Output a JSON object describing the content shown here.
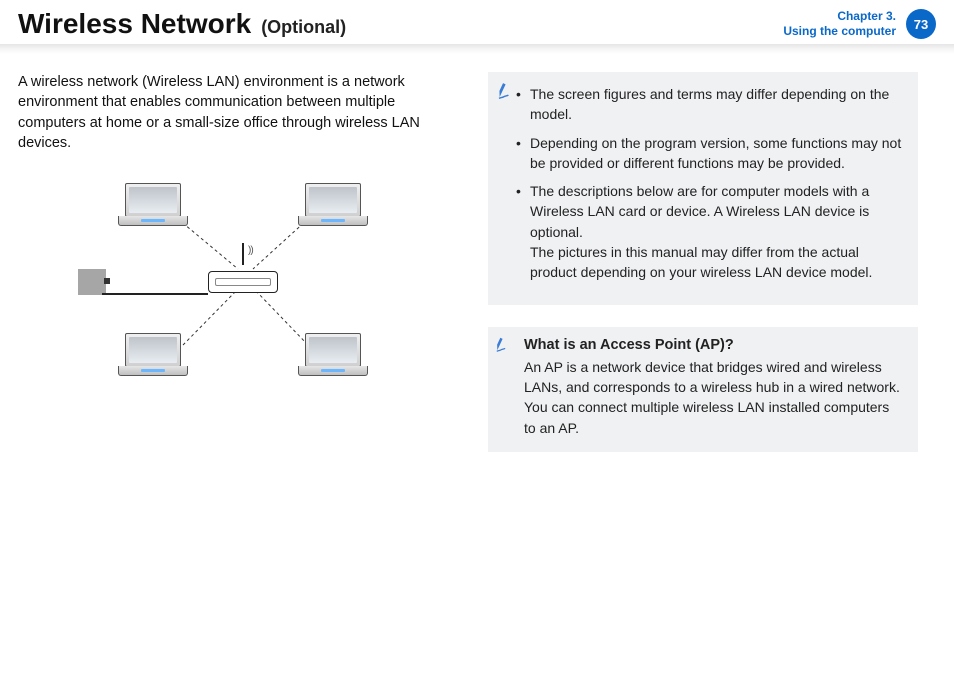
{
  "header": {
    "title": "Wireless Network",
    "subtitle": "(Optional)",
    "chapter_line1": "Chapter 3.",
    "chapter_line2": "Using the computer",
    "page": "73"
  },
  "intro": "A wireless network (Wireless LAN) environment is a network environment that enables communication between multiple computers at home or a small-size office through wireless LAN devices.",
  "notes": {
    "b1": "The screen figures and terms may differ depending on the model.",
    "b2": "Depending on the program version, some functions may not be provided or different functions may be provided.",
    "b3a": "The descriptions below are for computer models with a Wireless LAN card or device. A Wireless LAN device is optional.",
    "b3b": "The pictures in this manual may differ from the actual product depending on your wireless LAN device model."
  },
  "ap_box": {
    "heading": "What is an Access Point (AP)?",
    "text": "An AP is a network device that bridges wired and wireless LANs, and corresponds to a wireless hub in a wired network. You can connect multiple wireless LAN installed computers to an AP."
  }
}
